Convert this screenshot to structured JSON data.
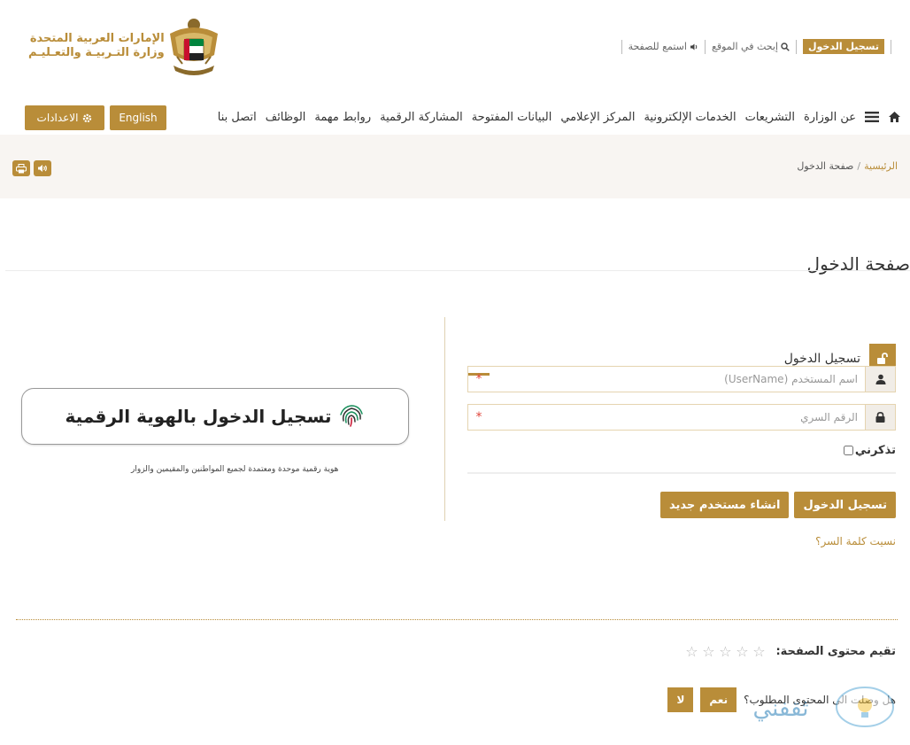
{
  "header": {
    "ministry_line1": "الإمارات العربية المتحدة",
    "ministry_line2": "وزارة التـربيـة والتعـليـم",
    "top_links": {
      "login": "تسجيل الدخول",
      "search": "إبحث في الموقع",
      "listen": "استمع للصفحة"
    }
  },
  "nav": {
    "items": [
      "عن الوزارة",
      "التشريعات",
      "الخدمات الإلكترونية",
      "المركز الإعلامي",
      "البيانات المفتوحة",
      "المشاركة الرقمية",
      "روابط مهمة",
      "الوظائف",
      "اتصل بنا"
    ],
    "english_label": "English",
    "settings_label": "الاعدادات"
  },
  "breadcrumb": {
    "home": "الرئيسية",
    "separator": "/",
    "current": "صفحة الدخول"
  },
  "page": {
    "title": "صفحة الدخول"
  },
  "login": {
    "panel_title": "تسجيل الدخول",
    "username_placeholder": "اسم المستخدم (UserName)",
    "password_placeholder": "الرقم السري",
    "required_mark": "*",
    "remember_label": "تذكرني",
    "login_button": "تسجيل الدخول",
    "register_button": "انشاء مستخدم جديد",
    "forgot_link": "نسيت كلمة السر؟"
  },
  "uae_pass": {
    "button_text": "تسجيل الدخول بالهوية الرقمية",
    "description": "هوية رقمية موحدة ومعتمدة لجميع المواطنين والمقيمين والزوار"
  },
  "rating": {
    "label": "تقيم محتوى الصفحة:",
    "stars": [
      "☆",
      "☆",
      "☆",
      "☆",
      "☆"
    ],
    "question": "هل وصلت الى المحتوى المطلوب؟",
    "yes": "نعم",
    "no": "لا"
  },
  "watermark": {
    "text": "ثقفني"
  },
  "colors": {
    "accent": "#b98d39",
    "band": "#f8f5f2",
    "required": "#e0463b"
  }
}
